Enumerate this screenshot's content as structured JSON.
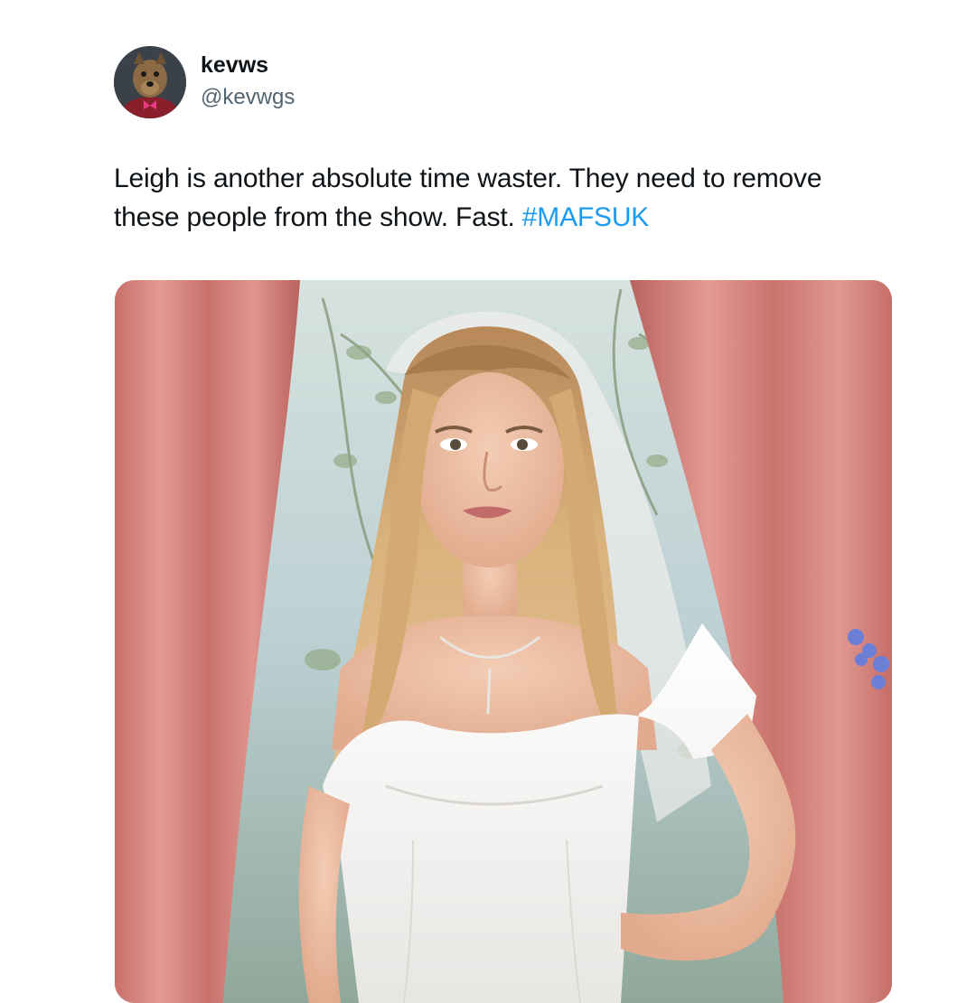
{
  "author": {
    "display_name": "kevws",
    "handle": "@kevwgs",
    "avatar_icon": "dog-puppet-avatar"
  },
  "tweet": {
    "text_line1": "Leigh is another absolute time waster. They need to remove",
    "text_line2_prefix": "these people from the show. Fast. ",
    "hashtag": "#MAFSUK"
  },
  "media": {
    "description_icon": "photo-bride-in-white-dress"
  },
  "colors": {
    "link": "#1d9bf0",
    "text": "#0f1419",
    "secondary": "#536471",
    "curtain": "#d9867f"
  }
}
